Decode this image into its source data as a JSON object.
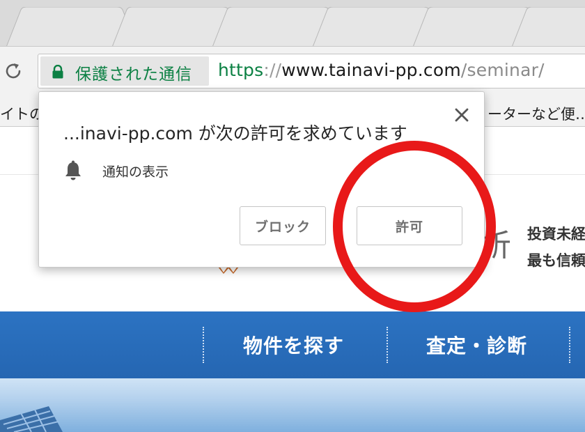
{
  "browser": {
    "security_label": "保護された通信",
    "url": {
      "scheme": "https",
      "separator": "://",
      "host": "www.tainavi-pp.com",
      "path": "/seminar/"
    },
    "bookmarks": {
      "left_fragment": "イトの",
      "right_fragment": "ーターなど便…"
    }
  },
  "popup": {
    "title": "...inavi-pp.com が次の許可を求めています",
    "permission_icon": "bell-icon",
    "permission_label": "通知の表示",
    "block_label": "ブロック",
    "allow_label": "許可"
  },
  "page": {
    "kanji_fragment": "析",
    "tagline_1": "投資未経",
    "tagline_2": "最も信頼",
    "nav": [
      "物件を探す",
      "査定・診断"
    ]
  },
  "colors": {
    "secure_green": "#0b8043",
    "nav_blue": "#2a6dbd",
    "highlight_red": "#e81919"
  }
}
